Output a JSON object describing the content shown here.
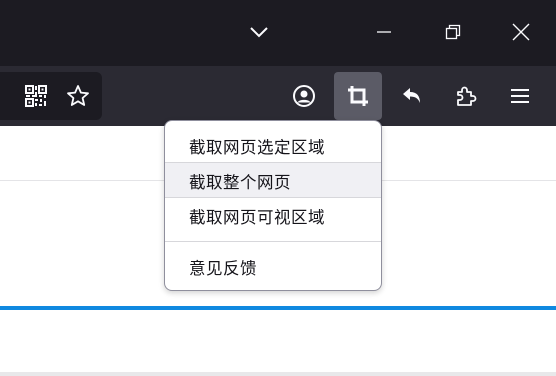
{
  "window": {
    "list_tabs_icon": "chevron-down-icon",
    "minimize_icon": "minimize-icon",
    "restore_icon": "restore-icon",
    "close_icon": "close-icon"
  },
  "urlbar": {
    "qr_icon": "qr-code-icon",
    "bookmark_icon": "star-icon"
  },
  "toolbar": {
    "account_icon": "account-icon",
    "screenshot_icon": "crop-icon",
    "back_icon": "undo-arrow-icon",
    "extensions_icon": "puzzle-icon",
    "menu_icon": "hamburger-menu-icon"
  },
  "screenshot_menu": {
    "items": [
      {
        "label": "截取网页选定区域"
      },
      {
        "label": "截取整个网页"
      },
      {
        "label": "截取网页可视区域"
      }
    ],
    "feedback_label": "意见反馈"
  },
  "colors": {
    "titlebar": "#1c1b22",
    "toolbar": "#2b2a33",
    "active_button": "#5b5b66",
    "accent_line": "#0f89e0"
  }
}
